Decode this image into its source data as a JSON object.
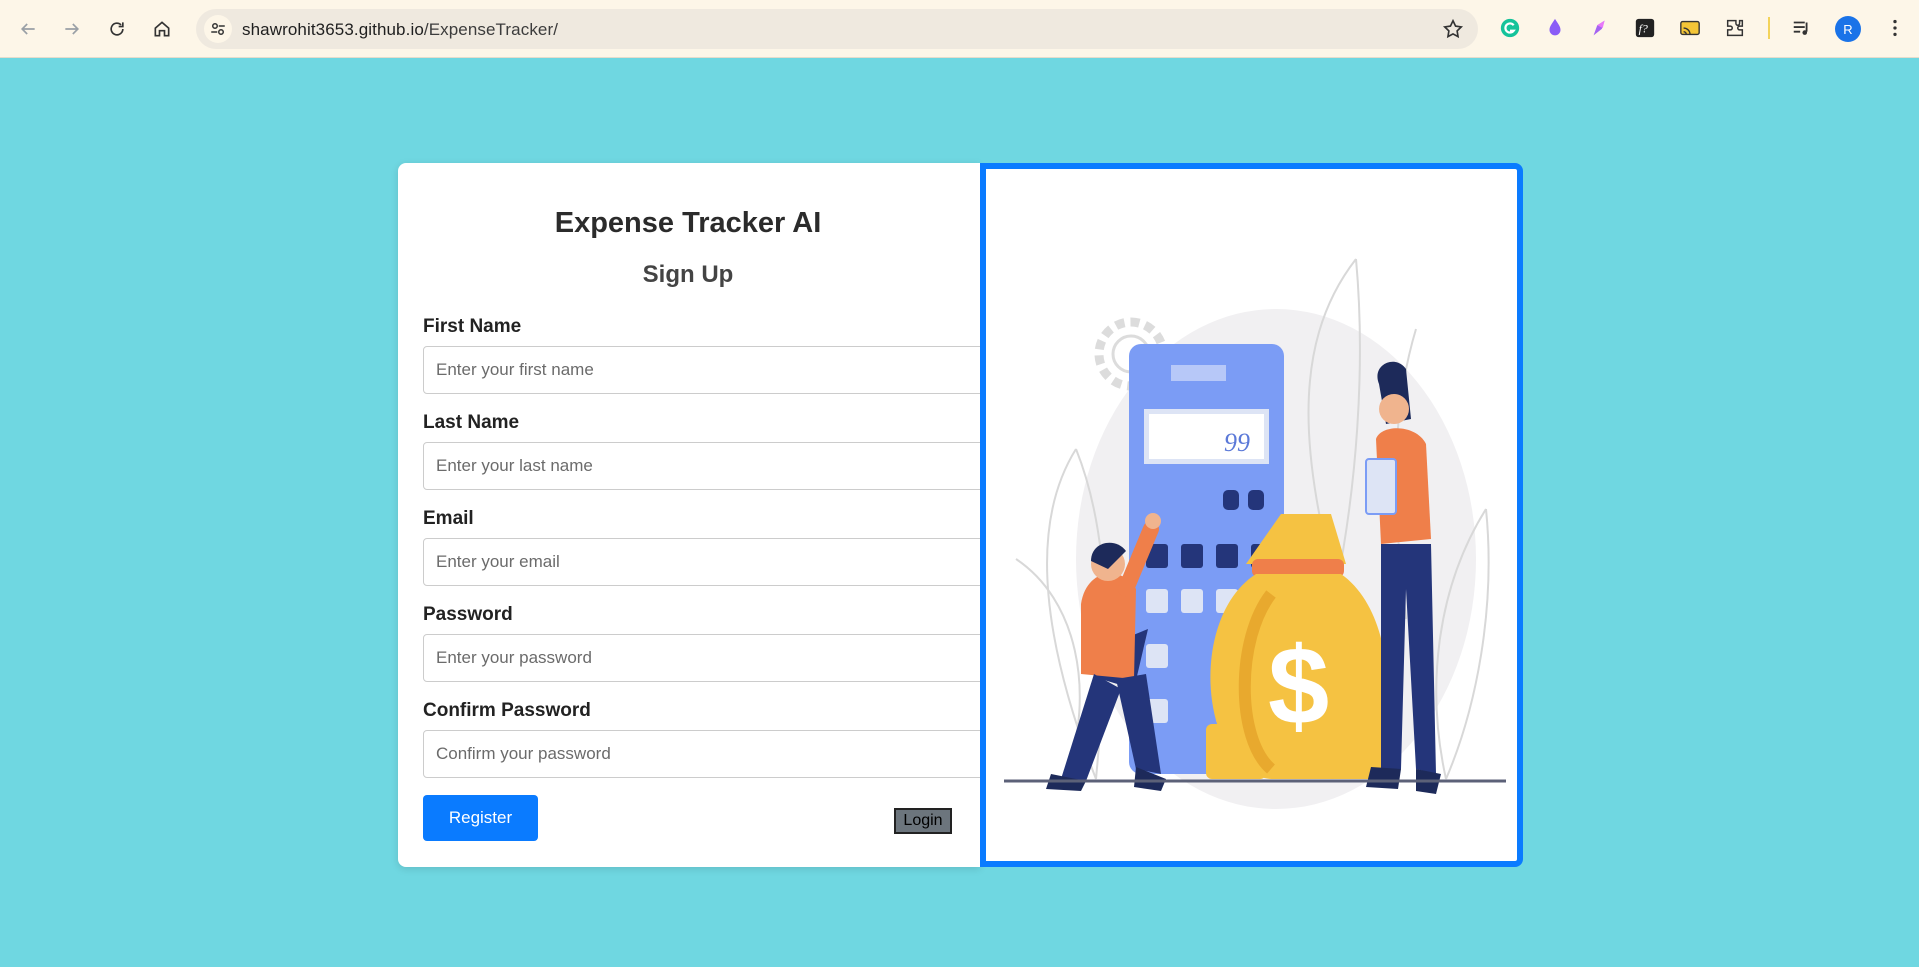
{
  "browser": {
    "url_host": "shawrohit3653.github.io",
    "url_path": "/ExpenseTracker/",
    "profile_initial": "R",
    "icons": [
      "back-icon",
      "forward-icon",
      "reload-icon",
      "home-icon",
      "site-settings-icon",
      "bookmark-star-icon",
      "grammarly-icon",
      "drop-icon",
      "brush-icon",
      "function-icon",
      "cast-icon",
      "extensions-icon",
      "media-queue-icon",
      "menu-icon"
    ]
  },
  "form": {
    "app_title": "Expense Tracker AI",
    "page_subtitle": "Sign Up",
    "fields": [
      {
        "label": "First Name",
        "placeholder": "Enter your first name",
        "value": ""
      },
      {
        "label": "Last Name",
        "placeholder": "Enter your last name",
        "value": ""
      },
      {
        "label": "Email",
        "placeholder": "Enter your email",
        "value": ""
      },
      {
        "label": "Password",
        "placeholder": "Enter your password",
        "value": ""
      },
      {
        "label": "Confirm Password",
        "placeholder": "Confirm your password",
        "value": ""
      }
    ],
    "register_label": "Register",
    "login_label": "Login"
  },
  "illustration": {
    "calculator_display": "99",
    "currency_symbol": "$"
  },
  "colors": {
    "page_background": "#6fd7e1",
    "accent": "#0a7bff",
    "calculator": "#7b9cf5",
    "money_bag": "#f5c242",
    "shirt": "#ef7f4a",
    "pants": "#24357a"
  }
}
